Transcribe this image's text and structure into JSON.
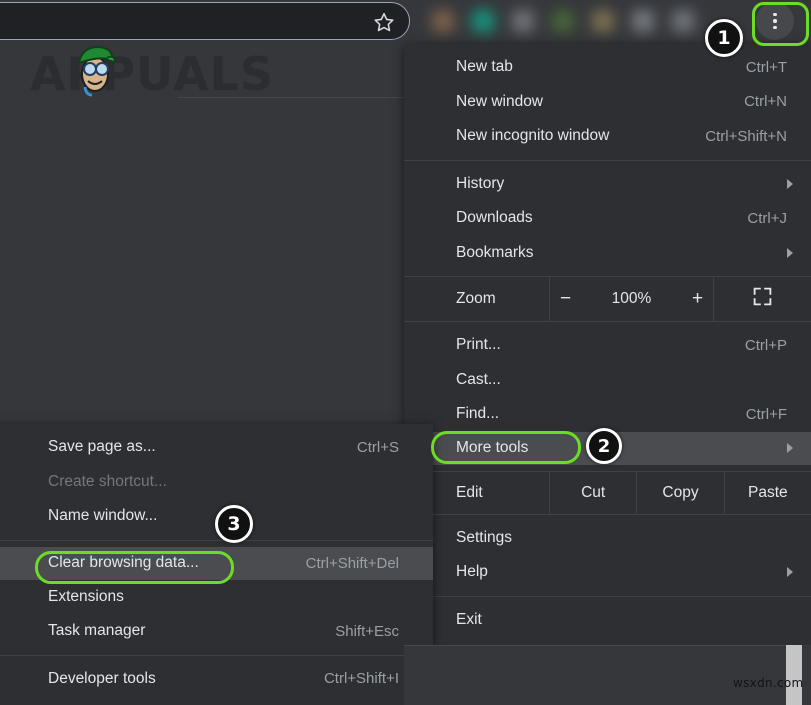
{
  "omnibox": {
    "value": "",
    "placeholder": "",
    "bookmark_icon": "star-icon"
  },
  "toolbar": {
    "menu_button_icon": "three-dot-menu-icon",
    "favicon_colors": [
      "#8a6a4f",
      "#12a58a",
      "#7b7e83",
      "#4d6e3a",
      "#8b7a55",
      "#82868b",
      "#7d8288"
    ]
  },
  "watermark_logo": {
    "text": "APPUALS"
  },
  "main_menu": {
    "groups": [
      {
        "items": [
          {
            "label": "New tab",
            "accel": "Ctrl+T",
            "arrow": false,
            "disabled": false
          },
          {
            "label": "New window",
            "accel": "Ctrl+N",
            "arrow": false,
            "disabled": false
          },
          {
            "label": "New incognito window",
            "accel": "Ctrl+Shift+N",
            "arrow": false,
            "disabled": false
          }
        ]
      },
      {
        "items": [
          {
            "label": "History",
            "accel": "",
            "arrow": true,
            "disabled": false
          },
          {
            "label": "Downloads",
            "accel": "Ctrl+J",
            "arrow": false,
            "disabled": false
          },
          {
            "label": "Bookmarks",
            "accel": "",
            "arrow": true,
            "disabled": false
          }
        ]
      }
    ],
    "zoom_row": {
      "label": "Zoom",
      "minus": "−",
      "percent": "100%",
      "plus": "+",
      "fullscreen_icon": "fullscreen-icon"
    },
    "group_print": [
      {
        "label": "Print...",
        "accel": "Ctrl+P",
        "arrow": false,
        "disabled": false
      },
      {
        "label": "Cast...",
        "accel": "",
        "arrow": false,
        "disabled": false
      },
      {
        "label": "Find...",
        "accel": "Ctrl+F",
        "arrow": false,
        "disabled": false
      },
      {
        "label": "More tools",
        "accel": "",
        "arrow": true,
        "disabled": false,
        "hover": true
      }
    ],
    "edit_row": {
      "label": "Edit",
      "actions": [
        "Cut",
        "Copy",
        "Paste"
      ]
    },
    "group_settings": [
      {
        "label": "Settings",
        "accel": "",
        "arrow": false,
        "disabled": false
      },
      {
        "label": "Help",
        "accel": "",
        "arrow": true,
        "disabled": false
      }
    ],
    "group_exit": [
      {
        "label": "Exit",
        "accel": "",
        "arrow": false,
        "disabled": false
      }
    ]
  },
  "sub_menu": {
    "group_a": [
      {
        "label": "Save page as...",
        "accel": "Ctrl+S",
        "disabled": false
      },
      {
        "label": "Create shortcut...",
        "accel": "",
        "disabled": true
      },
      {
        "label": "Name window...",
        "accel": "",
        "disabled": false
      }
    ],
    "group_b": [
      {
        "label": "Clear browsing data...",
        "accel": "Ctrl+Shift+Del",
        "disabled": false,
        "hover": true
      },
      {
        "label": "Extensions",
        "accel": "",
        "disabled": false
      },
      {
        "label": "Task manager",
        "accel": "Shift+Esc",
        "disabled": false
      }
    ],
    "group_c": [
      {
        "label": "Developer tools",
        "accel": "Ctrl+Shift+I",
        "disabled": false
      }
    ]
  },
  "annotations": {
    "highlight_color": "#6ddc24",
    "badges": [
      {
        "number": "1",
        "target": "three-dot-menu-button"
      },
      {
        "number": "2",
        "target": "more-tools-menu-item"
      },
      {
        "number": "3",
        "target": "clear-browsing-data-menu-item"
      }
    ]
  },
  "footer": {
    "watermark": "wsxdn.com"
  }
}
